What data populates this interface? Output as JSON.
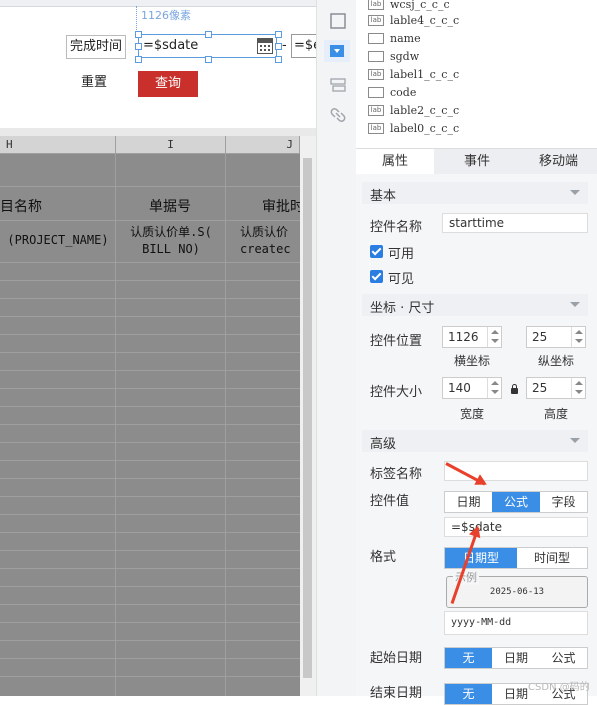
{
  "preview": {
    "px_label": "1126像素",
    "label_text": "完成时间",
    "date_value": "=$sdate",
    "dash": "-",
    "date2_value": "=$edate",
    "reset_label": "重置",
    "query_label": "查询"
  },
  "sheet": {
    "columns": [
      "H",
      "I",
      "J"
    ],
    "title_row": [
      "目名称",
      "单据号",
      "审批时"
    ],
    "data_row": [
      [
        "(PROJECT_NAME)"
      ],
      [
        "认质认价单.S(",
        "BILL NO)"
      ],
      [
        "认质认价",
        "createc"
      ]
    ]
  },
  "component_list": [
    {
      "icon": "lab",
      "name": "wcsj_c_c_c"
    },
    {
      "icon": "lab",
      "name": "lable4_c_c_c"
    },
    {
      "icon": "",
      "name": "name"
    },
    {
      "icon": "",
      "name": "sgdw"
    },
    {
      "icon": "lab",
      "name": "label1_c_c_c"
    },
    {
      "icon": "",
      "name": "code"
    },
    {
      "icon": "lab",
      "name": "lable2_c_c_c"
    },
    {
      "icon": "lab",
      "name": "label0_c_c_c"
    }
  ],
  "tabs": [
    "属性",
    "事件",
    "移动端"
  ],
  "props": {
    "section_basic": "基本",
    "ctrl_name_label": "控件名称",
    "ctrl_name_value": "starttime",
    "enabled_label": "可用",
    "visible_label": "可见",
    "section_pos": "坐标 · 尺寸",
    "pos_label": "控件位置",
    "pos_x": "1126",
    "pos_y": "25",
    "pos_x_caption": "横坐标",
    "pos_y_caption": "纵坐标",
    "size_label": "控件大小",
    "width": "140",
    "height": "25",
    "width_caption": "宽度",
    "height_caption": "高度",
    "section_adv": "高级",
    "tag_label": "标签名称",
    "tag_value": "",
    "value_label": "控件值",
    "value_options": [
      "日期",
      "公式",
      "字段"
    ],
    "value_formula": "=$sdate",
    "format_label": "格式",
    "format_options": [
      "日期型",
      "时间型"
    ],
    "example_title": "示例",
    "example_value": "2025-06-13",
    "format_pattern": "yyyy-MM-dd",
    "start_label": "起始日期",
    "start_options": [
      "无",
      "日期",
      "公式"
    ],
    "end_label": "结束日期",
    "end_options": [
      "无",
      "日期",
      "公式"
    ]
  },
  "watermark": "CSDN @码的",
  "colors": {
    "accent": "#3a8ee6",
    "query_button": "#c9302c",
    "annotation_arrow": "#e8402a"
  }
}
